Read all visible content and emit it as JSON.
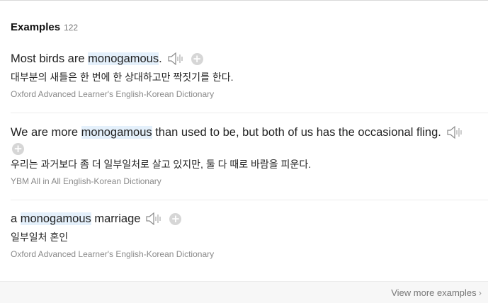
{
  "header": {
    "title": "Examples",
    "count": "122"
  },
  "examples": [
    {
      "en_before": "Most birds are ",
      "en_highlight": "monogamous",
      "en_after": ".",
      "ko": "대부분의 새들은 한 번에 한 상대하고만 짝짓기를 한다.",
      "source": "Oxford Advanced Learner's English-Korean Dictionary"
    },
    {
      "en_before": "We are more ",
      "en_highlight": "monogamous",
      "en_after": " than used to be, but both of us has the occasional fling.",
      "ko": "우리는 과거보다 좀 더 일부일처로 살고 있지만, 둘 다 때로 바람을 피운다.",
      "source": "YBM All in All English-Korean Dictionary"
    },
    {
      "en_before": "a ",
      "en_highlight": "monogamous",
      "en_after": " marriage",
      "ko": "일부일처 혼인",
      "source": "Oxford Advanced Learner's English-Korean Dictionary"
    }
  ],
  "icons": {
    "sound": "speaker-sound-icon",
    "add": "add-to-wordbook-plus-icon"
  },
  "highlight_color": "#e4f0fb",
  "footer": {
    "more_label": "View more examples",
    "chevron": "›"
  }
}
